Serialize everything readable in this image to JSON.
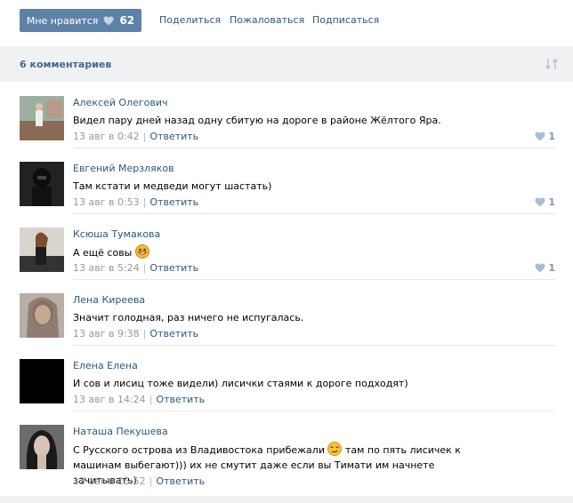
{
  "actions": {
    "like_label": "Мне нравится",
    "like_count": "62",
    "share": "Поделиться",
    "report": "Пожаловаться",
    "subscribe": "Подписаться"
  },
  "comments_header": {
    "title": "6 комментариев"
  },
  "colors": {
    "brand": "#5e81a8",
    "link": "#2b587a",
    "muted": "#999999",
    "header_bg": "#eff1f3"
  },
  "comments": [
    {
      "author": "Алексей Олегович",
      "text": "Видел пару дней назад одну сбитую на дороге в районе Жёлтого Яра.",
      "date": "13 авг в 0:42",
      "reply": "Ответить",
      "likes": "1"
    },
    {
      "author": "Евгений Мерзляков",
      "text": "Там кстати и медведи могут шастать)",
      "date": "13 авг в 0:53",
      "reply": "Ответить",
      "likes": "1"
    },
    {
      "author": "Ксюша Тумакова",
      "text": "А ещё совы",
      "date": "13 авг в 5:24",
      "reply": "Ответить",
      "likes": "1"
    },
    {
      "author": "Лена Киреева",
      "text": "Значит голодная, раз ничего не испугалась.",
      "date": "13 авг в 9:38",
      "reply": "Ответить",
      "likes": ""
    },
    {
      "author": "Елена Елена",
      "text": "И сов и лисиц тоже видели) лисички стаями к дороге подходят)",
      "date": "13 авг в 14:24",
      "reply": "Ответить",
      "likes": ""
    },
    {
      "author": "Наташа Пекушева",
      "text_part1": "С Русского острова из Владивостока прибежали",
      "text_part2": "там по пять лисичек к машинам выбегают))) их не смутит даже если вы Тимати им начнете зачитывать)",
      "date": "13 авг в 15:52",
      "reply": "Ответить",
      "likes": ""
    }
  ]
}
